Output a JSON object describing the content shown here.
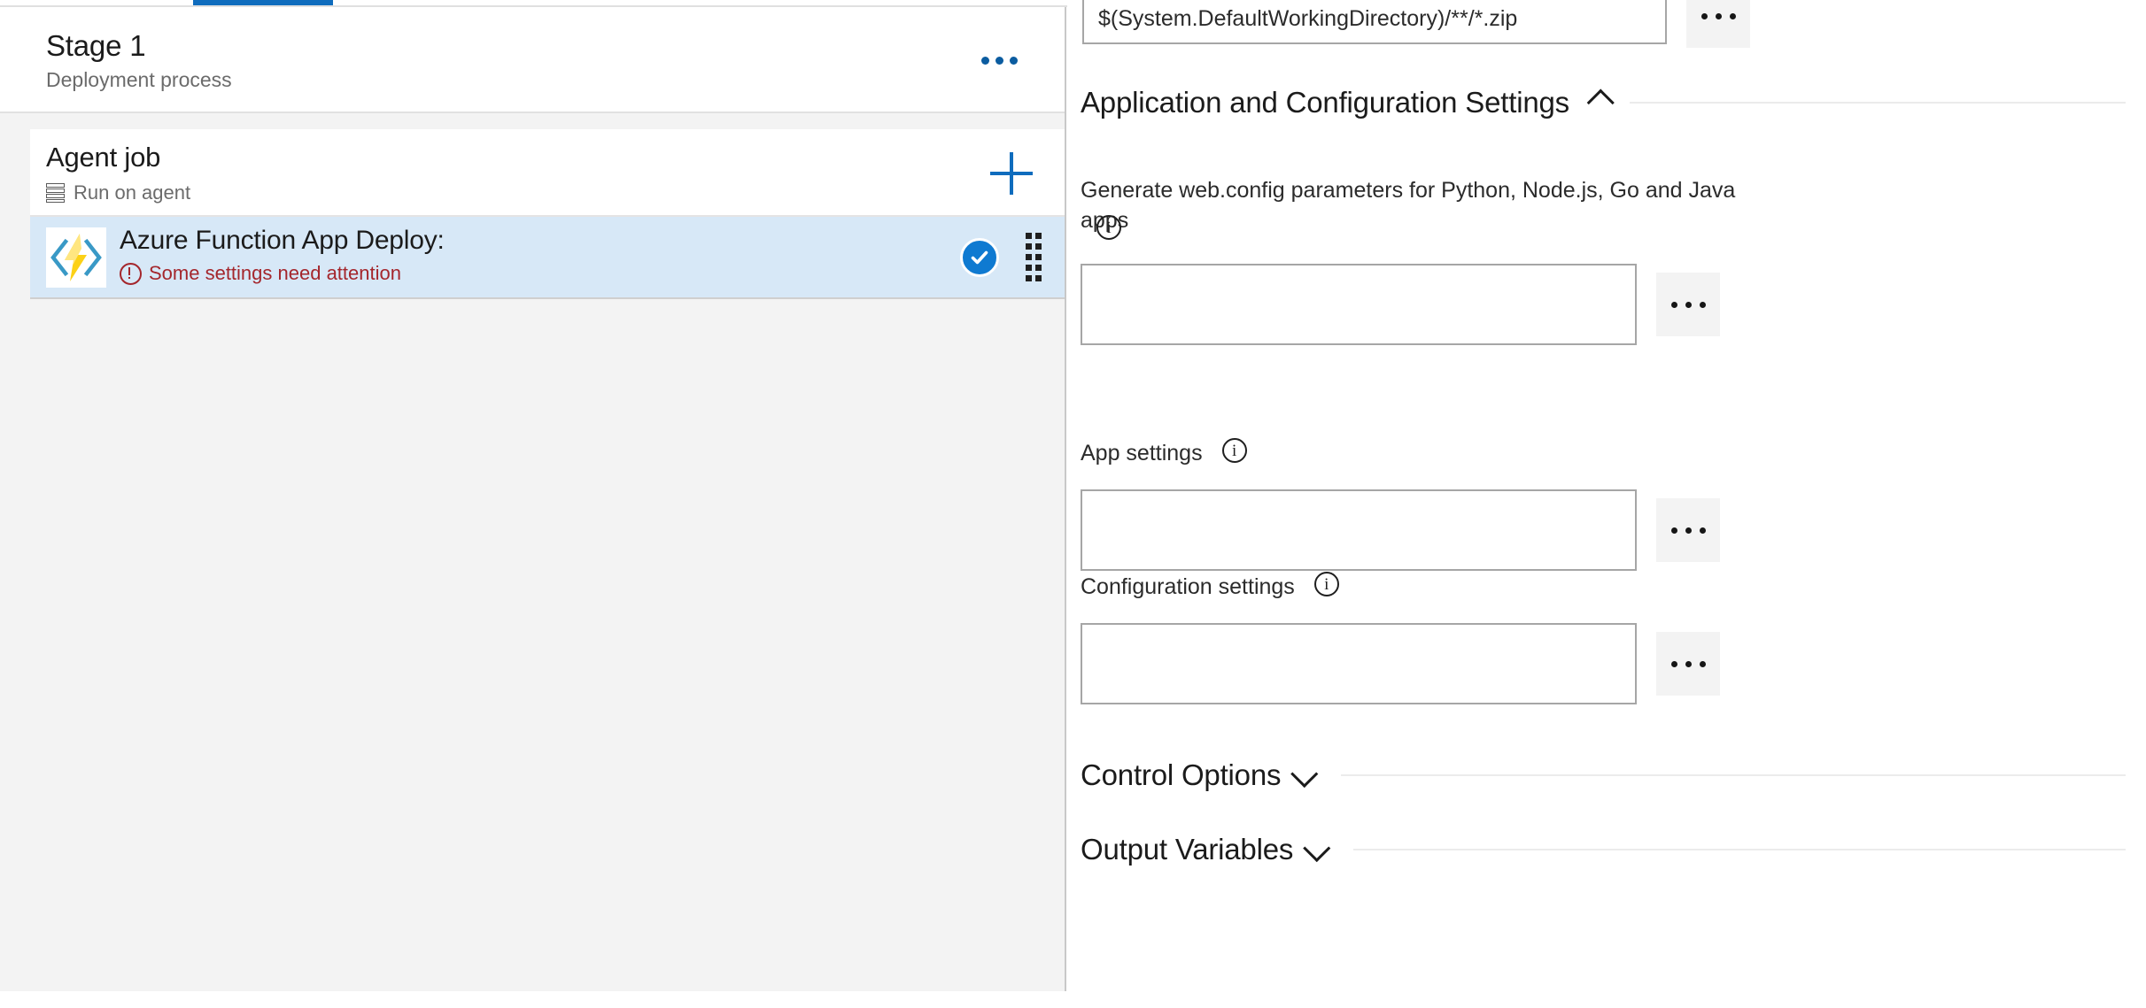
{
  "tabs": {
    "active_tab_indicator": "tasks-tab"
  },
  "left_panel": {
    "stage": {
      "title": "Stage 1",
      "subtitle": "Deployment process",
      "more_label": "more-options"
    },
    "job": {
      "name": "Agent job",
      "sub_label": "Run on agent",
      "add_label": "add-task"
    },
    "task": {
      "title": "Azure Function App Deploy:",
      "status": "Some settings need attention",
      "status_color": "#a4262c",
      "enabled": true,
      "icon": "azure-function-icon"
    }
  },
  "right_panel": {
    "package_field": {
      "value": "$(System.DefaultWorkingDirectory)/**/*.zip",
      "placeholder": "",
      "browse_label": "..."
    },
    "sections": [
      {
        "title": "Application and Configuration Settings",
        "state": "expanded",
        "chevron": "chevron-up-icon"
      },
      {
        "title": "Control Options",
        "state": "collapsed",
        "chevron": "chevron-down-icon"
      },
      {
        "title": "Output Variables",
        "state": "collapsed",
        "chevron": "chevron-down-icon"
      }
    ],
    "fields": [
      {
        "label": "Generate web.config parameters for Python, Node.js, Go and Java apps",
        "value": "",
        "placeholder": "",
        "has_info": true,
        "browse_label": "..."
      },
      {
        "label": "App settings",
        "value": "",
        "placeholder": "",
        "has_info": true,
        "browse_label": "..."
      },
      {
        "label": "Configuration settings",
        "value": "",
        "placeholder": "",
        "has_info": true,
        "browse_label": "..."
      }
    ]
  },
  "colors": {
    "accent": "#0f6cbd",
    "panel_bg": "#f3f3f3",
    "selected_row": "#d7e8f7",
    "error": "#a4262c",
    "check": "#0f7ad1"
  }
}
